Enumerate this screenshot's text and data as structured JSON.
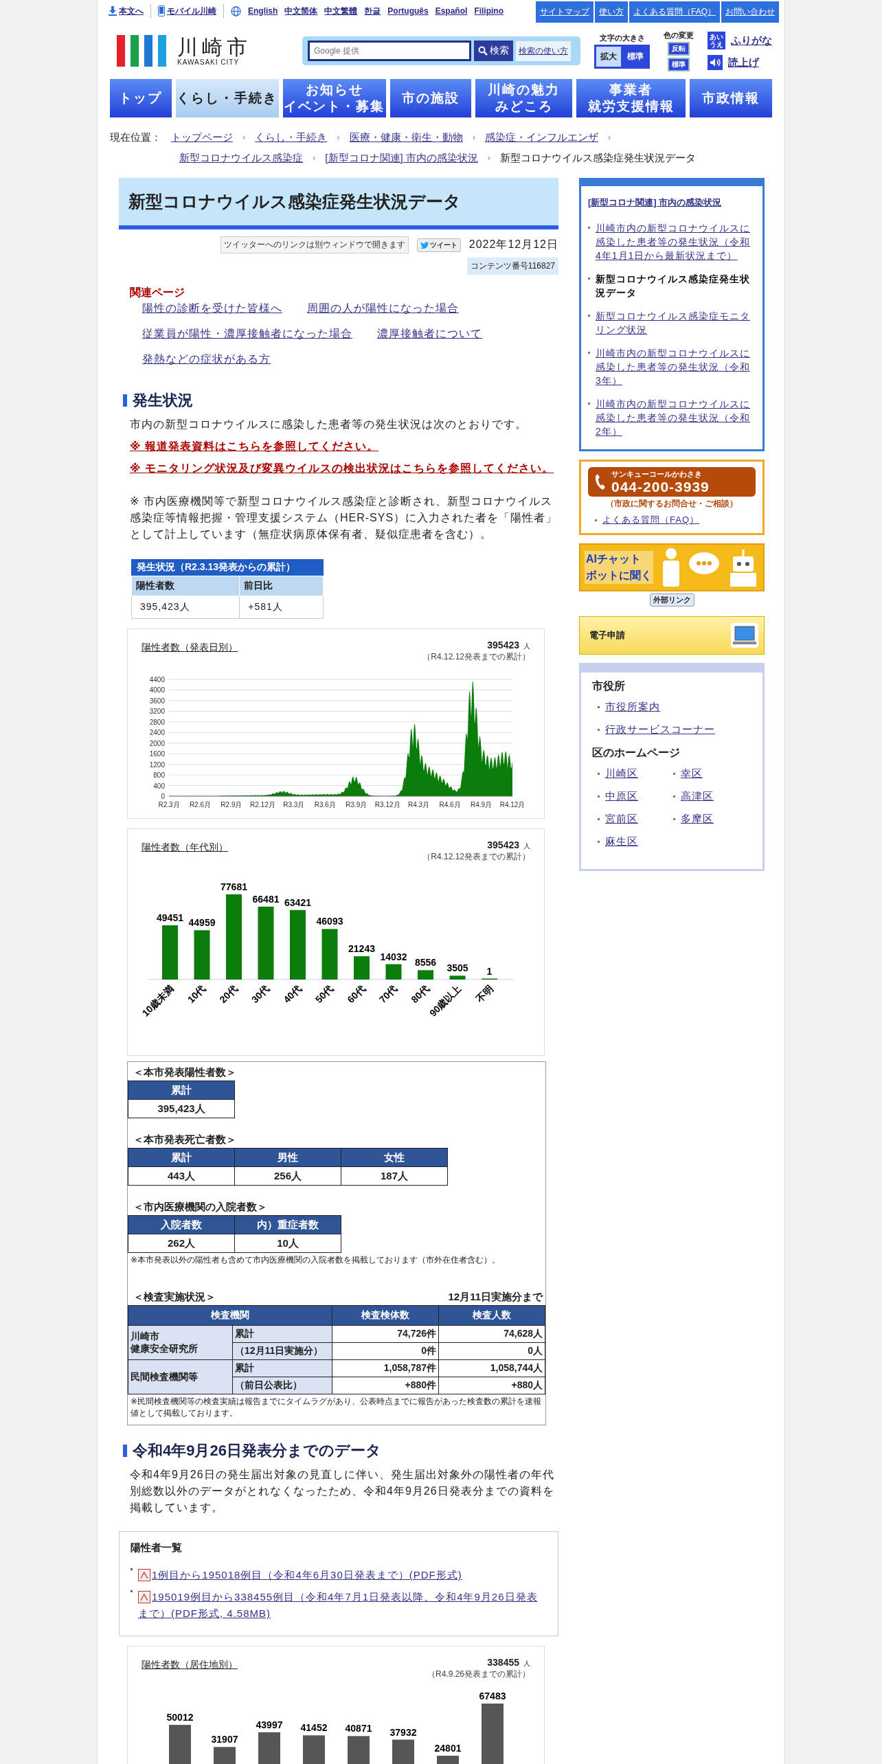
{
  "top_bar": {
    "skip_link": "本文へ",
    "mobile_link": "モバイル川崎",
    "languages": [
      "English",
      "中文简体",
      "中文繁體",
      "한글",
      "Português",
      "Español",
      "Filipino"
    ],
    "utility_links": [
      "サイトマップ",
      "使い方",
      "よくある質問（FAQ）",
      "お問い合わせ"
    ]
  },
  "header": {
    "logo": {
      "name": "川崎市",
      "roman": "KAWASAKI CITY"
    },
    "search": {
      "placeholder": "Google 提供",
      "button": "検索",
      "help": "検索の使い方"
    },
    "font_size": {
      "label": "文字の大きさ",
      "options": [
        {
          "label": "拡大",
          "selected": true
        },
        {
          "label": "標準",
          "selected": false
        }
      ]
    },
    "color": {
      "label": "色の変更",
      "options": [
        "反転",
        "標準"
      ]
    },
    "furigana": {
      "icon_text": "あいうえ",
      "label": "ふりがな"
    },
    "read_aloud": {
      "label": "読上げ"
    }
  },
  "nav": [
    {
      "lines": [
        "トップ"
      ],
      "selected": false
    },
    {
      "lines": [
        "くらし・手続き"
      ],
      "selected": true
    },
    {
      "lines": [
        "お知らせ",
        "イベント・募集"
      ],
      "selected": false
    },
    {
      "lines": [
        "市の施設"
      ],
      "selected": false
    },
    {
      "lines": [
        "川崎の魅力",
        "みどころ"
      ],
      "selected": false
    },
    {
      "lines": [
        "事業者",
        "就労支援情報"
      ],
      "selected": false
    },
    {
      "lines": [
        "市政情報"
      ],
      "selected": false
    }
  ],
  "breadcrumb": {
    "label": "現在位置：",
    "separator": "›",
    "links": [
      "トップページ",
      "くらし・手続き",
      "医療・健康・衛生・動物",
      "感染症・インフルエンザ",
      "新型コロナウイルス感染症",
      "[新型コロナ関連] 市内の感染状況"
    ],
    "current": "新型コロナウイルス感染症発生状況データ"
  },
  "page": {
    "title": "新型コロナウイルス感染症発生状況データ",
    "twitter_note": "ツイッターへのリンクは別ウィンドウで開きます",
    "tweet": "ツイート",
    "date": "2022年12月12日",
    "content_number": "コンテンツ番号116827",
    "related": {
      "heading": "関連ページ",
      "links": [
        "陽性の診断を受けた皆様へ",
        "周囲の人が陽性になった場合",
        "従業員が陽性・濃厚接触者になった場合",
        "濃厚接触者について",
        "発熱などの症状がある方"
      ]
    },
    "section1": {
      "heading": "発生状況",
      "intro": "市内の新型コロナウイルスに感染した患者等の発生状況は次のとおりです。",
      "alert_links": [
        "※ 報道発表資料はこちらを参照してください。",
        "※ モニタリング状況及び変異ウイルスの検出状況はこちらを参照してください。"
      ],
      "note": "※ 市内医療機関等で新型コロナウイルス感染症と診断され、新型コロナウイルス感染症等情報把握・管理支援システム（HER-SYS）に入力された者を「陽性者」として計上しています（無症状病原体保有者、疑似症患者を含む）。",
      "summary": {
        "caption": "発生状況（R2.3.13発表からの累計）",
        "headers": [
          "陽性者数",
          "前日比"
        ],
        "values": [
          "395,423人",
          "+581人"
        ]
      }
    },
    "daily_chart": {
      "title": "陽性者数（発表日別）",
      "total": "395423",
      "unit": "人",
      "note": "（R4.12.12発表までの累計）",
      "yticks": [
        "4400",
        "4000",
        "3600",
        "3200",
        "2800",
        "2400",
        "2000",
        "1600",
        "1200",
        "800",
        "400",
        "0"
      ],
      "xlabels": [
        "R2.3月",
        "R2.6月",
        "R2.9月",
        "R2.12月",
        "R3.3月",
        "R3.6月",
        "R3.9月",
        "R3.12月",
        "R4.3月",
        "R4.6月",
        "R4.9月",
        "R4.12月"
      ]
    },
    "age_chart": {
      "title": "陽性者数（年代別）",
      "total": "395423",
      "unit": "人",
      "note": "（R4.12.12発表までの累計）",
      "chart_data": {
        "type": "bar",
        "categories": [
          "10歳未満",
          "10代",
          "20代",
          "30代",
          "40代",
          "50代",
          "60代",
          "70代",
          "80代",
          "90歳以上",
          "不明"
        ],
        "series": [
          {
            "color": "#0a7d0a",
            "values": [
              49451,
              44959,
              77681,
              66481,
              63421,
              46093,
              21243,
              14032,
              8556,
              3505,
              1
            ]
          }
        ],
        "data_labels": true
      }
    },
    "stat_tables": {
      "positives": {
        "title": "＜本市発表陽性者数＞",
        "headers": [
          "累計"
        ],
        "values": [
          "395,423人"
        ]
      },
      "deaths": {
        "title": "＜本市発表死亡者数＞",
        "headers": [
          "累計",
          "男性",
          "女性"
        ],
        "values": [
          "443人",
          "256人",
          "187人"
        ]
      },
      "hospital": {
        "title": "＜市内医療機関の入院者数＞",
        "headers": [
          "入院者数",
          "内）重症者数"
        ],
        "values": [
          "262人",
          "10人"
        ],
        "note": "※本市発表以外の陽性者も含めて市内医療機関の入院者数を掲載しております（市外在住者含む）。"
      },
      "tests": {
        "title": "＜検査実施状況＞",
        "as_of": "12月11日実施分まで",
        "headers": [
          "検査機関",
          "検査検体数",
          "検査人数"
        ],
        "groups": [
          {
            "name": [
              "川崎市",
              "健康安全研究所"
            ],
            "rows": [
              {
                "label": "累計",
                "specimens": "74,726件",
                "people": "74,628人"
              },
              {
                "label": "（12月11日実施分）",
                "specimens": "0件",
                "people": "0人"
              }
            ]
          },
          {
            "name": [
              "民間検査機関等"
            ],
            "rows": [
              {
                "label": "累計",
                "specimens": "1,058,787件",
                "people": "1,058,744人"
              },
              {
                "label": "（前日公表比）",
                "specimens": "+880件",
                "people": "+880人"
              }
            ]
          }
        ],
        "note": "※民間検査機関等の検査実績は報告までにタイムラグがあり、公表時点までに報告があった検査数の累計を速報値として掲載しております。"
      }
    },
    "section2": {
      "heading": "令和4年9月26日発表分までのデータ",
      "intro": "令和4年9月26日の発生届出対象の見直しに伴い、発生届出対象外の陽性者の年代別総数以外のデータがとれなくなったため、令和4年9月26日発表分までの資料を掲載しています。",
      "list_box": {
        "heading": "陽性者一覧",
        "links": [
          "1例目から195018例目（令和4年6月30日発表まで）(PDF形式)",
          "195019例目から338455例目（令和4年7月1日発表以降、令和4年9月26日発表まで）(PDF形式, 4.58MB)"
        ]
      },
      "residence_chart": {
        "title": "陽性者数（居住地別）",
        "total": "338455",
        "unit": "人",
        "note": "（R4.9.26発表までの累計）",
        "value_labels": [
          "50012",
          "31907",
          "43997",
          "41452",
          "40871",
          "37932",
          "24801",
          "67483"
        ]
      }
    }
  },
  "sidebar": {
    "local_nav": {
      "title": "[新型コロナ関連] 市内の感染状況",
      "items": [
        {
          "label": "川崎市内の新型コロナウイルスに感染した患者等の発生状況（令和4年1月1日から最新状況まで）",
          "selected": false
        },
        {
          "label": "新型コロナウイルス感染症発生状況データ",
          "selected": true
        },
        {
          "label": "新型コロナウイルス感染症モニタリング状況",
          "selected": false
        },
        {
          "label": "川崎市内の新型コロナウイルスに感染した患者等の発生状況（令和3年）",
          "selected": false
        },
        {
          "label": "川崎市内の新型コロナウイルスに感染した患者等の発生状況（令和2年）",
          "selected": false
        }
      ]
    },
    "call_center": {
      "name": "サンキューコールかわさき",
      "phone": "044-200-3939",
      "note": "（市政に関するお問合せ・ご相談）",
      "faq": "よくある質問（FAQ）"
    },
    "ai_chat": {
      "lines": [
        "AIチャット",
        "ボットに聞く"
      ],
      "badge": "外部リンク"
    },
    "e_application": {
      "label": "電子申請"
    },
    "offices": {
      "city_hall": {
        "heading": "市役所",
        "links": [
          "市役所案内",
          "行政サービスコーナー"
        ]
      },
      "wards": {
        "heading": "区のホームページ",
        "links": [
          "川崎区",
          "幸区",
          "中原区",
          "高津区",
          "宮前区",
          "多摩区",
          "麻生区"
        ]
      }
    }
  }
}
